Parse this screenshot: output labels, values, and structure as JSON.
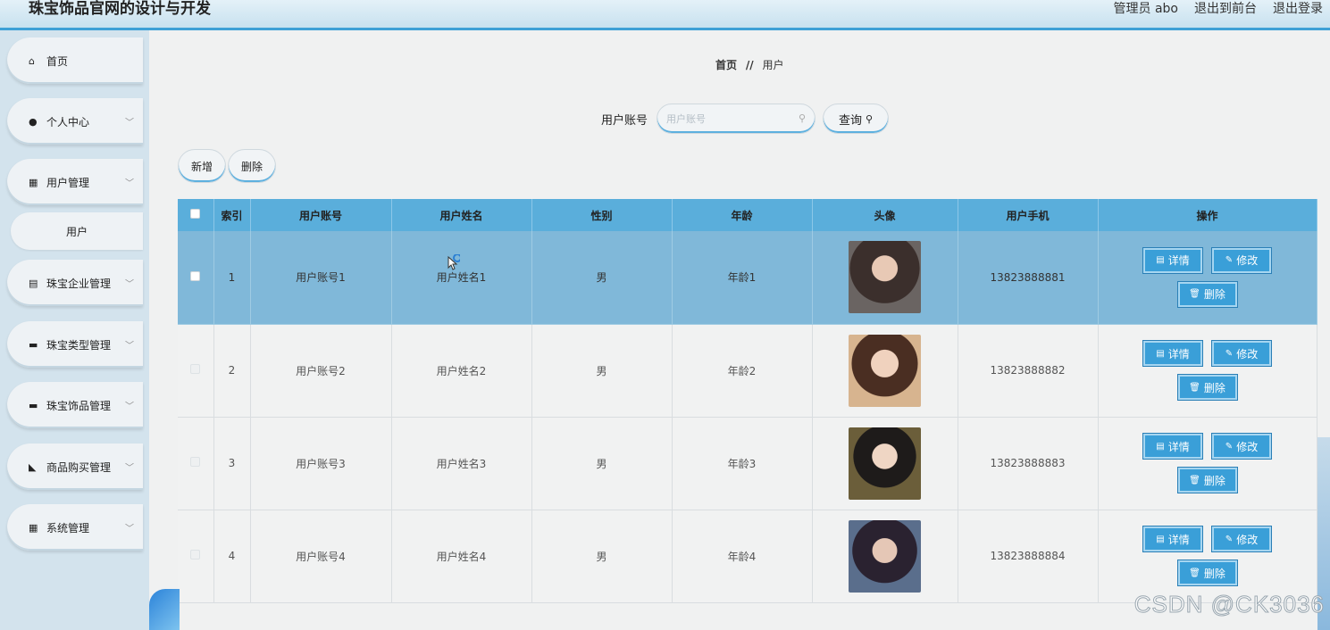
{
  "app": {
    "title": "珠宝饰品官网的设计与开发"
  },
  "topbar": {
    "admin": "管理员 abo",
    "to_front": "退出到前台",
    "logout": "退出登录"
  },
  "sidebar": {
    "items": [
      {
        "label": "首页",
        "icon": "home-icon",
        "glyph": "⌂",
        "expandable": false
      },
      {
        "label": "个人中心",
        "icon": "user-icon",
        "glyph": "●",
        "expandable": true
      },
      {
        "label": "用户管理",
        "icon": "grid-icon",
        "glyph": "▦",
        "expandable": true
      },
      {
        "label": "珠宝企业管理",
        "icon": "clipboard-icon",
        "glyph": "▤",
        "expandable": true
      },
      {
        "label": "珠宝类型管理",
        "icon": "monitor-icon",
        "glyph": "▬",
        "expandable": true
      },
      {
        "label": "珠宝饰品管理",
        "icon": "chat-icon",
        "glyph": "▬",
        "expandable": true
      },
      {
        "label": "商品购买管理",
        "icon": "cart-icon",
        "glyph": "◣",
        "expandable": true
      },
      {
        "label": "系统管理",
        "icon": "grid-icon",
        "glyph": "▦",
        "expandable": true
      }
    ],
    "sub_item": {
      "label": "用户"
    }
  },
  "breadcrumb": {
    "home": "首页",
    "separator": "//",
    "current": "用户"
  },
  "search": {
    "label": "用户账号",
    "placeholder": "用户账号",
    "value": "",
    "button": "查询"
  },
  "actions": {
    "add": "新增",
    "delete": "删除"
  },
  "table": {
    "columns": [
      "",
      "索引",
      "用户账号",
      "用户姓名",
      "性别",
      "年龄",
      "头像",
      "用户手机",
      "操作"
    ],
    "rows": [
      {
        "index": "1",
        "account": "用户账号1",
        "name": "用户姓名1",
        "gender": "男",
        "age": "年龄1",
        "phone": "13823888881",
        "selected": true
      },
      {
        "index": "2",
        "account": "用户账号2",
        "name": "用户姓名2",
        "gender": "男",
        "age": "年龄2",
        "phone": "13823888882",
        "selected": false
      },
      {
        "index": "3",
        "account": "用户账号3",
        "name": "用户姓名3",
        "gender": "男",
        "age": "年龄3",
        "phone": "13823888883",
        "selected": false
      },
      {
        "index": "4",
        "account": "用户账号4",
        "name": "用户姓名4",
        "gender": "男",
        "age": "年龄4",
        "phone": "13823888884",
        "selected": false
      }
    ],
    "row_actions": {
      "detail": "详情",
      "edit": "修改",
      "delete": "删除"
    }
  },
  "watermark": "CSDN @CK3036",
  "colors": {
    "accent": "#3a9fd8",
    "header_bg": "#5aaedb",
    "selected_row": "#80b8d9",
    "sidebar_bg": "#d3e3ed"
  }
}
